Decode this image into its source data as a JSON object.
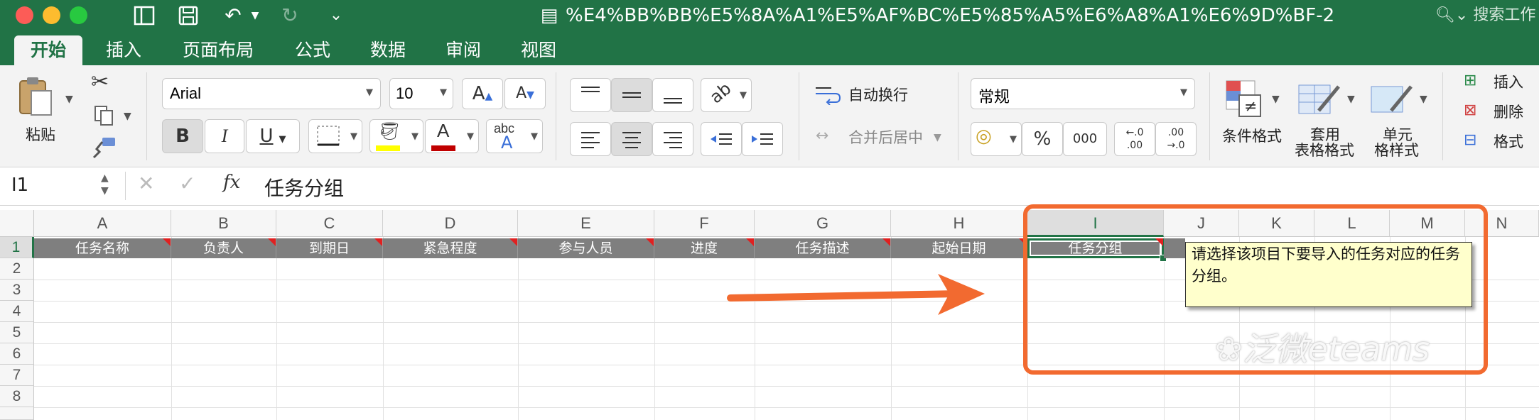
{
  "window": {
    "title": "%E4%BB%BB%E5%8A%A1%E5%AF%BC%E5%85%A5%E6%A8%A1%E6%9D%BF-2",
    "search_placeholder": "搜索工作"
  },
  "tabs": [
    {
      "label": "开始",
      "active": true
    },
    {
      "label": "插入"
    },
    {
      "label": "页面布局"
    },
    {
      "label": "公式"
    },
    {
      "label": "数据"
    },
    {
      "label": "审阅"
    },
    {
      "label": "视图"
    }
  ],
  "ribbon": {
    "paste_label": "粘贴",
    "font_name": "Arial",
    "font_size": "10",
    "bold": "B",
    "italic": "I",
    "underline": "U",
    "font_color_glyph": "A",
    "abc_label": "abc",
    "wrap_text": "自动换行",
    "merge_center": "合并后居中",
    "number_format": "常规",
    "percent": "%",
    "thousands": "000",
    "dec_inc_top": "←.0",
    "dec_inc_bottom": ".00",
    "dec_dec_top": ".00",
    "dec_dec_bottom": "→.0",
    "conditional_format": "条件格式",
    "table_format_1": "套用",
    "table_format_2": "表格格式",
    "cell_style_1": "单元",
    "cell_style_2": "格样式",
    "insert": "插入",
    "delete": "删除",
    "format": "格式"
  },
  "formula_bar": {
    "name_box": "I1",
    "fx": "fx",
    "content": "任务分组"
  },
  "sheet": {
    "columns": [
      "A",
      "B",
      "C",
      "D",
      "E",
      "F",
      "G",
      "H",
      "I",
      "J",
      "K",
      "L",
      "M",
      "N"
    ],
    "rows": [
      "1",
      "2",
      "3",
      "4",
      "5",
      "6",
      "7",
      "8"
    ],
    "header_row": [
      "任务名称",
      "负责人",
      "到期日",
      "紧急程度",
      "参与人员",
      "进度",
      "任务描述",
      "起始日期",
      "任务分组"
    ],
    "selected_cell": "I1",
    "comment": "请选择该项目下要导入的任务对应的任务分组。"
  },
  "annotation": {
    "arrow_color": "#f26a30",
    "box_color": "#f26a30"
  },
  "watermark": "泛微eteams"
}
